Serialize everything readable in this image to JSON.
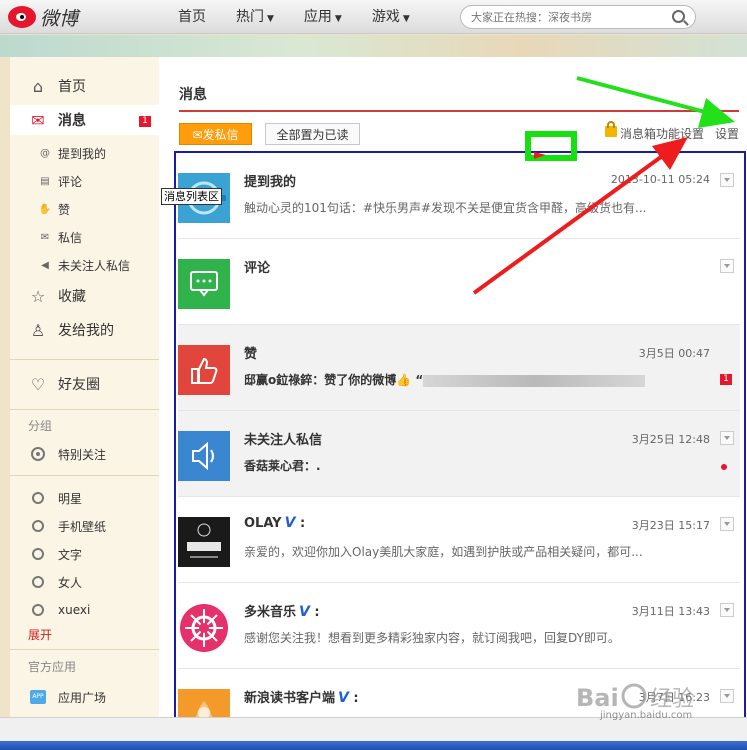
{
  "header": {
    "logo_text": "微博",
    "nav": [
      "首页",
      "热门",
      "应用",
      "游戏"
    ],
    "search_placeholder": "大家正在热搜：深夜书房"
  },
  "sidebar": {
    "home": "首页",
    "messages": "消息",
    "messages_badge": "1",
    "sub_items": [
      "提到我的",
      "评论",
      "赞",
      "私信",
      "未关注人私信"
    ],
    "favorites": "收藏",
    "sent_to_me": "发给我的",
    "friends_circle": "好友圈",
    "group_head": "分组",
    "special_follow": "特别关注",
    "groups": [
      "明星",
      "手机壁纸",
      "文字",
      "女人",
      "xuexi"
    ],
    "expand": "展开",
    "official_head": "官方应用",
    "app_square": "应用广场"
  },
  "main": {
    "title": "消息",
    "send_button": "发私信",
    "mark_read_button": "全部置为已读",
    "box_settings": "消息箱功能设置",
    "settings": "设置",
    "list_tooltip": "消息列表区"
  },
  "messages": [
    {
      "title": "提到我的",
      "time": "2013-10-11 05:24",
      "preview": "触动心灵的101句话：#快乐男声#发现不关是便宜货含甲醛，高级货也有...",
      "avatar": "at-icon"
    },
    {
      "title": "评论",
      "time": "",
      "preview": "",
      "avatar": "comment-icon"
    },
    {
      "title": "赞",
      "time": "3月5日 00:47",
      "preview": "邸赢o鉝祿錊：赞了你的微博👍 “",
      "badge": "1",
      "avatar": "thumb-icon"
    },
    {
      "title": "未关注人私信",
      "time": "3月25日 12:48",
      "preview": "香菇莱心君：.",
      "avatar": "speaker-icon"
    },
    {
      "title": "OLAY",
      "time": "3月23日 15:17",
      "preview": "亲爱的，欢迎你加入Olay美肌大家庭，如遇到护肤或产品相关疑问，都可...",
      "avatar": "olay-logo"
    },
    {
      "title": "多米音乐",
      "time": "3月11日 13:43",
      "preview": "感谢您关注我！想看到更多精彩独家内容，就订阅我吧，回复DY即可。",
      "avatar": "duomi-logo"
    },
    {
      "title": "新浪读书客户端",
      "time": "3月7日 16:23",
      "preview": "",
      "avatar": "sina-book-logo"
    }
  ],
  "watermark": {
    "text": "jingyan.baidu.com"
  },
  "colors": {
    "brand_red": "#e6162d",
    "send_orange": "#ff9d0a",
    "frame_blue": "#1b1ba8",
    "annot_green": "#17e010",
    "annot_red": "#ee1c1c"
  }
}
